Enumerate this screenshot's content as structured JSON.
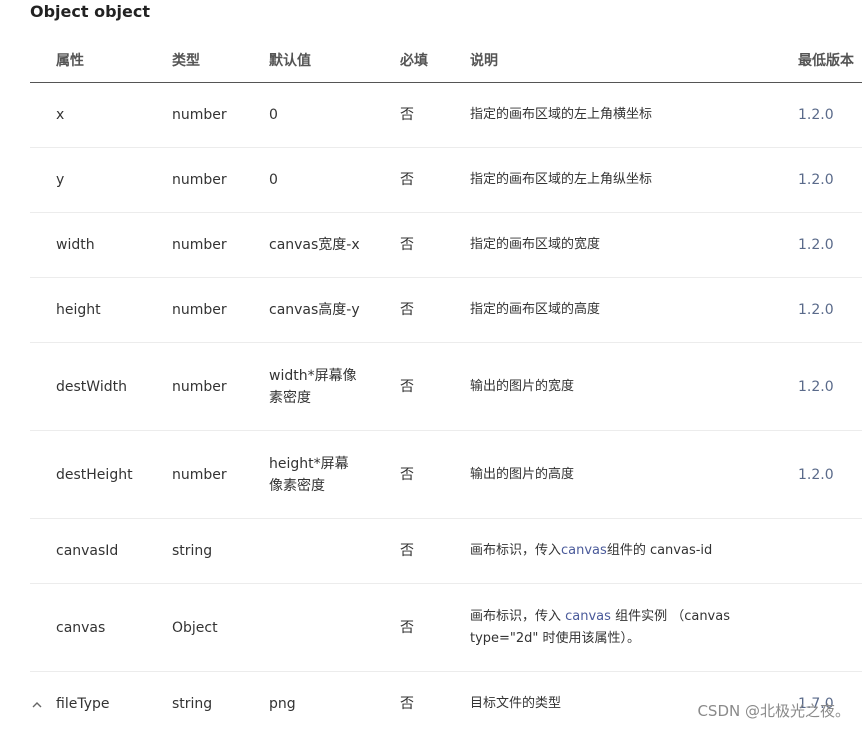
{
  "title": "Object object",
  "columns": [
    "属性",
    "类型",
    "默认值",
    "必填",
    "说明",
    "最低版本"
  ],
  "rows": [
    {
      "name": "x",
      "type": "number",
      "default": "0",
      "required": "否",
      "desc": "指定的画布区域的左上角横坐标",
      "version": "1.2.0"
    },
    {
      "name": "y",
      "type": "number",
      "default": "0",
      "required": "否",
      "desc": "指定的画布区域的左上角纵坐标",
      "version": "1.2.0"
    },
    {
      "name": "width",
      "type": "number",
      "default": "canvas宽度-x",
      "required": "否",
      "desc": "指定的画布区域的宽度",
      "version": "1.2.0"
    },
    {
      "name": "height",
      "type": "number",
      "default": "canvas高度-y",
      "required": "否",
      "desc": "指定的画布区域的高度",
      "version": "1.2.0"
    },
    {
      "name": "destWidth",
      "type": "number",
      "default_line1": "width*屏幕像",
      "default_line2": "素密度",
      "required": "否",
      "desc": "输出的图片的宽度",
      "version": "1.2.0"
    },
    {
      "name": "destHeight",
      "type": "number",
      "default_line1": "height*屏幕",
      "default_line2": "像素密度",
      "required": "否",
      "desc": "输出的图片的高度",
      "version": "1.2.0"
    },
    {
      "name": "canvasId",
      "type": "string",
      "default": "",
      "required": "否",
      "desc_pre": "画布标识，传入 ",
      "desc_link": "canvas",
      "desc_post": " 组件的 canvas-id",
      "version": ""
    },
    {
      "name": "canvas",
      "type": "Object",
      "default": "",
      "required": "否",
      "desc_pre": "画布标识，传入 ",
      "desc_link": "canvas",
      "desc_post": " 组件实例 （canvas",
      "desc_line2": "type=\"2d\" 时使用该属性）。",
      "version": ""
    },
    {
      "name": "fileType",
      "type": "string",
      "default": "png",
      "required": "否",
      "desc": "目标文件的类型",
      "version": "1.7.0"
    }
  ],
  "expand_icon": "chevron-up-icon",
  "watermark": "CSDN @北极光之夜。"
}
